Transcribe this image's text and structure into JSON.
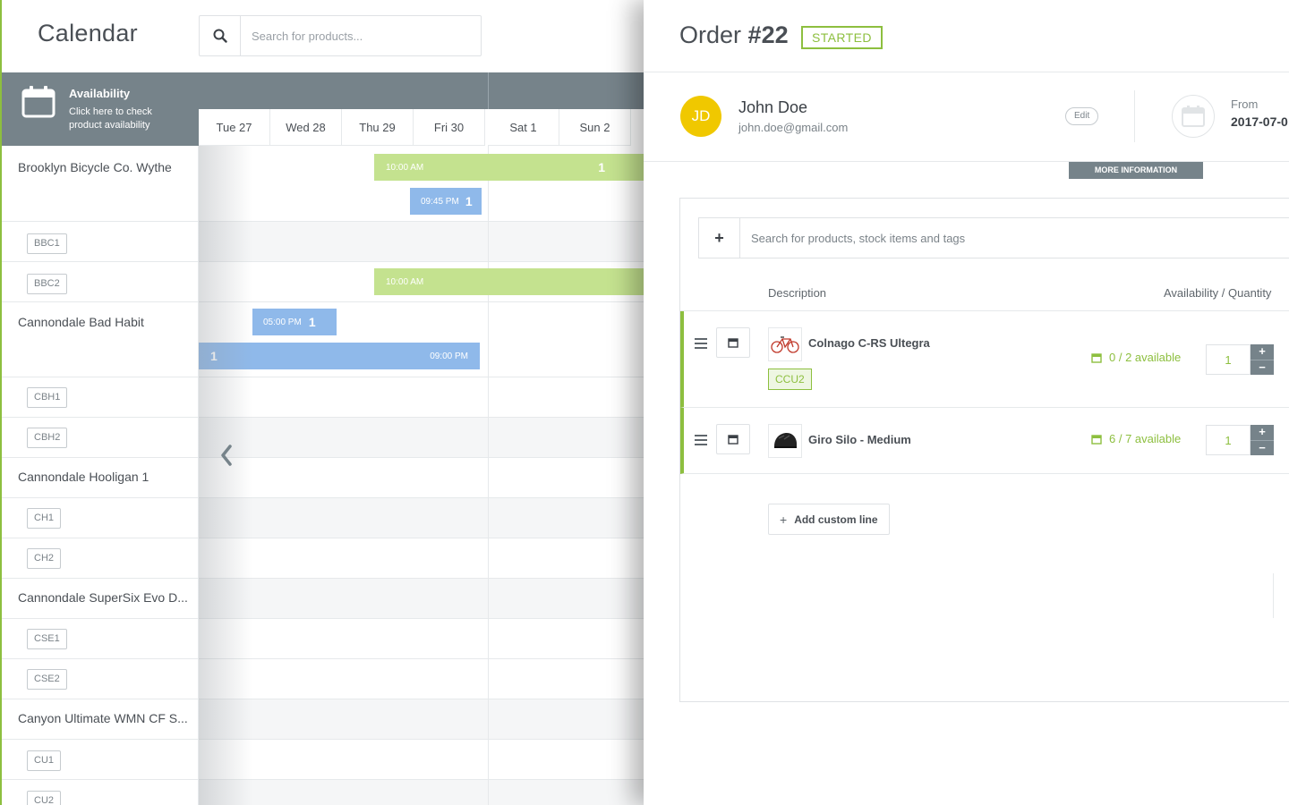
{
  "calendar": {
    "title": "Calendar",
    "search_placeholder": "Search for products...",
    "availability": {
      "title": "Availability",
      "subtitle": "Click here to check product availability"
    },
    "days": [
      "Tue 27",
      "Wed 28",
      "Thu 29",
      "Fri 30",
      "Sat 1",
      "Sun 2"
    ],
    "products": [
      {
        "name": "Brooklyn Bicycle Co. Wythe",
        "items": [
          "BBC1",
          "BBC2"
        ]
      },
      {
        "name": "Cannondale Bad Habit",
        "items": [
          "CBH1",
          "CBH2"
        ]
      },
      {
        "name": "Cannondale Hooligan 1",
        "items": [
          "CH1",
          "CH2"
        ]
      },
      {
        "name": "Cannondale SuperSix Evo D...",
        "items": [
          "CSE1",
          "CSE2"
        ]
      },
      {
        "name": "Canyon Ultimate WMN CF S...",
        "items": [
          "CU1",
          "CU2"
        ]
      }
    ],
    "bookings": [
      {
        "time": "10:00 AM",
        "count": "1",
        "color": "#c4e28f"
      },
      {
        "time": "09:45 PM",
        "count": "1",
        "color": "#8fb9ea"
      },
      {
        "time": "10:00 AM",
        "count": "",
        "color": "#c4e28f"
      },
      {
        "time": "05:00 PM",
        "count": "1",
        "color": "#8fb9ea"
      },
      {
        "time": "09:00 PM",
        "count": "1",
        "color": "#8fb9ea"
      }
    ]
  },
  "order": {
    "title_prefix": "Order",
    "number": "#22",
    "status": "STARTED",
    "customer": {
      "initials": "JD",
      "name": "John Doe",
      "email": "john.doe@gmail.com",
      "edit_label": "Edit"
    },
    "from": {
      "label": "From",
      "date": "2017-07-0"
    },
    "more_info_label": "MORE INFORMATION",
    "line_search_placeholder": "Search for products, stock items and tags",
    "columns": {
      "description": "Description",
      "availability": "Availability / Quantity"
    },
    "lines": [
      {
        "name": "Colnago C-RS Ultegra",
        "tag": "CCU2",
        "availability": "0 / 2 available",
        "quantity": "1",
        "icon": "bicycle-icon"
      },
      {
        "name": "Giro Silo - Medium",
        "tag": "",
        "availability": "6 / 7 available",
        "quantity": "1",
        "icon": "helmet-icon"
      }
    ],
    "add_custom_line_label": "Add custom line",
    "step_plus": "+",
    "step_minus": "−"
  },
  "colors": {
    "accent_green": "#8dbf3f",
    "slate": "#76838a",
    "booking_green": "#c4e28f",
    "booking_blue": "#8fb9ea",
    "avatar_yellow": "#f0c800"
  }
}
